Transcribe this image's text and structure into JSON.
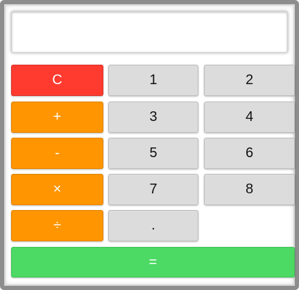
{
  "display": {
    "value": ""
  },
  "buttons": {
    "clear": "C",
    "add": "+",
    "subtract": "-",
    "multiply": "×",
    "divide": "÷",
    "one": "1",
    "two": "2",
    "three": "3",
    "four": "4",
    "five": "5",
    "six": "6",
    "seven": "7",
    "eight": "8",
    "decimal": ".",
    "equals": "="
  },
  "colors": {
    "clear": "#ff3b30",
    "operator": "#ff9500",
    "number": "#dcdcdc",
    "equals": "#4cd964"
  }
}
